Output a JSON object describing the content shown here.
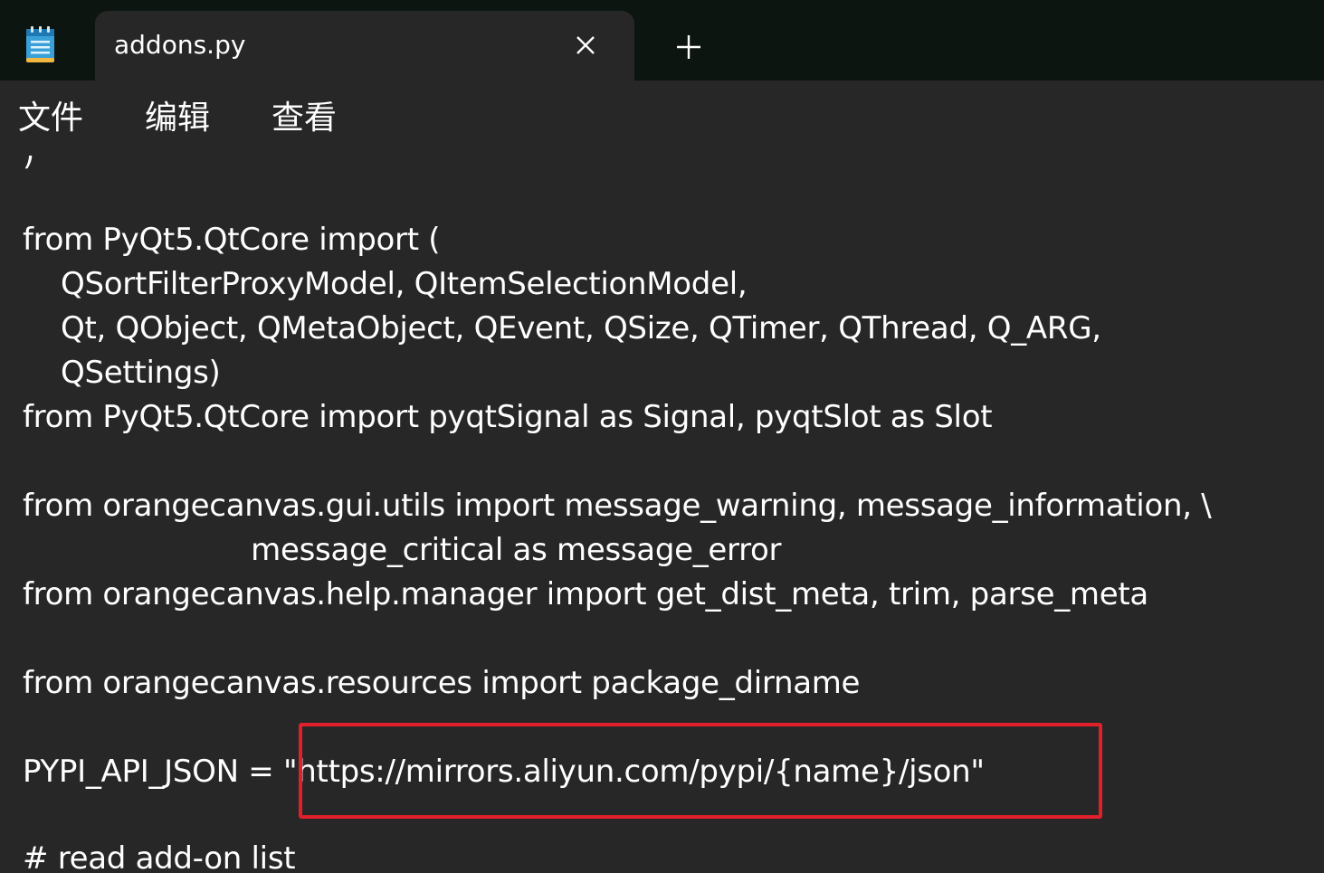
{
  "window": {
    "tab_title": "addons.py",
    "close_icon": "close-icon",
    "new_tab_icon": "plus-icon",
    "app_icon": "notepad-icon"
  },
  "menu": {
    "file": "文件",
    "edit": "编辑",
    "view": "查看"
  },
  "code": {
    "lines": [
      ")",
      "",
      "from PyQt5.QtCore import (",
      "    QSortFilterProxyModel, QItemSelectionModel,",
      "    Qt, QObject, QMetaObject, QEvent, QSize, QTimer, QThread, Q_ARG,",
      "    QSettings)",
      "from PyQt5.QtCore import pyqtSignal as Signal, pyqtSlot as Slot",
      "",
      "from orangecanvas.gui.utils import message_warning, message_information, \\",
      "                        message_critical as message_error",
      "from orangecanvas.help.manager import get_dist_meta, trim, parse_meta",
      "",
      "from orangecanvas.resources import package_dirname",
      "",
      "PYPI_API_JSON = \"https://mirrors.aliyun.com/pypi/{name}/json\"",
      "",
      "# read add-on list"
    ]
  },
  "colors": {
    "background": "#272727",
    "titlebar": "#0c1510",
    "text": "#ffffff",
    "highlight": "#e0202a"
  }
}
